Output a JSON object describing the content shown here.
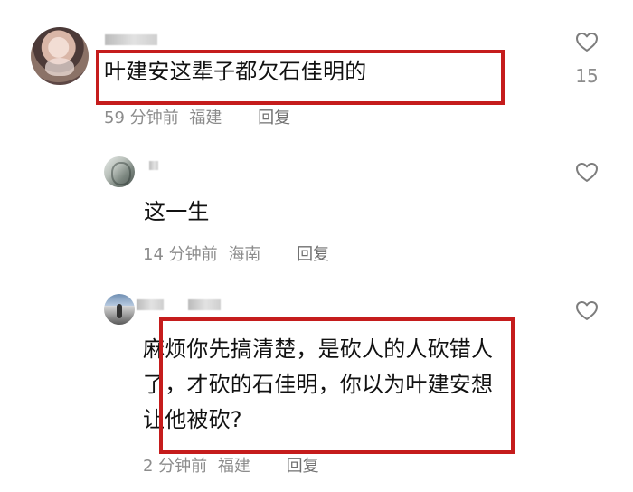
{
  "comments": [
    {
      "text": "叶建安这辈子都欠石佳明的",
      "time": "59 分钟前",
      "region": "福建",
      "reply_label": "回复",
      "like_count": "15"
    },
    {
      "text": "这一生",
      "time": "14 分钟前",
      "region": "海南",
      "reply_label": "回复",
      "like_count": ""
    },
    {
      "text": "麻烦你先搞清楚，是砍人的人砍错人了，才砍的石佳明，你以为叶建安想让他被砍?",
      "time": "2 分钟前",
      "region": "福建",
      "reply_label": "回复",
      "like_count": ""
    }
  ],
  "icons": {
    "like": "heart-icon",
    "avatar": "user-avatar"
  },
  "colors": {
    "highlight": "#c51c1c",
    "meta_text": "#8c8c8c",
    "reply_text": "#707070",
    "heart_stroke": "#7d7d7d"
  }
}
